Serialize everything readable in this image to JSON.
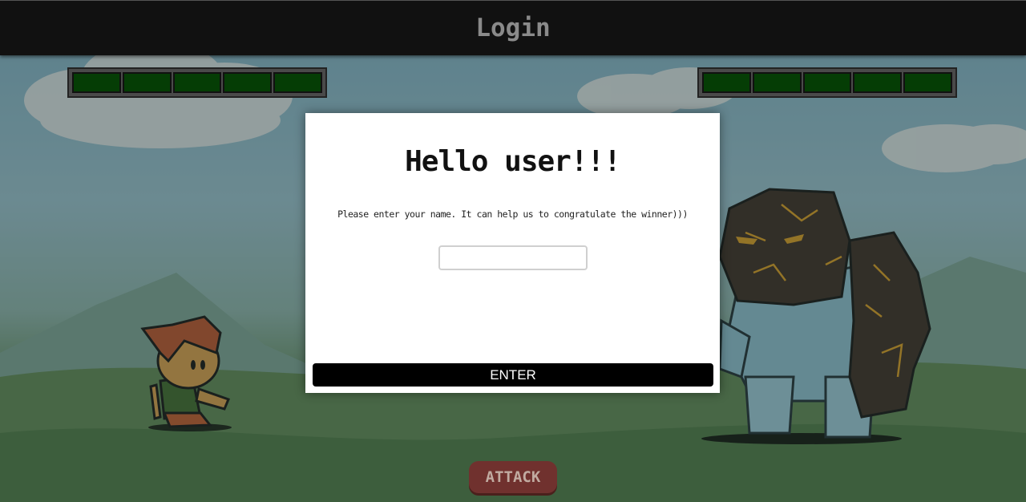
{
  "header": {
    "title": "Login"
  },
  "player": {
    "health_segments": 5
  },
  "enemy": {
    "health_segments": 5
  },
  "modal": {
    "heading": "Hello user!!!",
    "message": "Please enter your name. It can help us to congratulate the winner)))",
    "name_input_value": "",
    "name_input_placeholder": "",
    "enter_label": "ENTER"
  },
  "controls": {
    "attack_label": "ATTACK"
  },
  "colors": {
    "health_fill": "#053d05",
    "topbar": "#111111",
    "attack_button": "#7a2a2c"
  }
}
